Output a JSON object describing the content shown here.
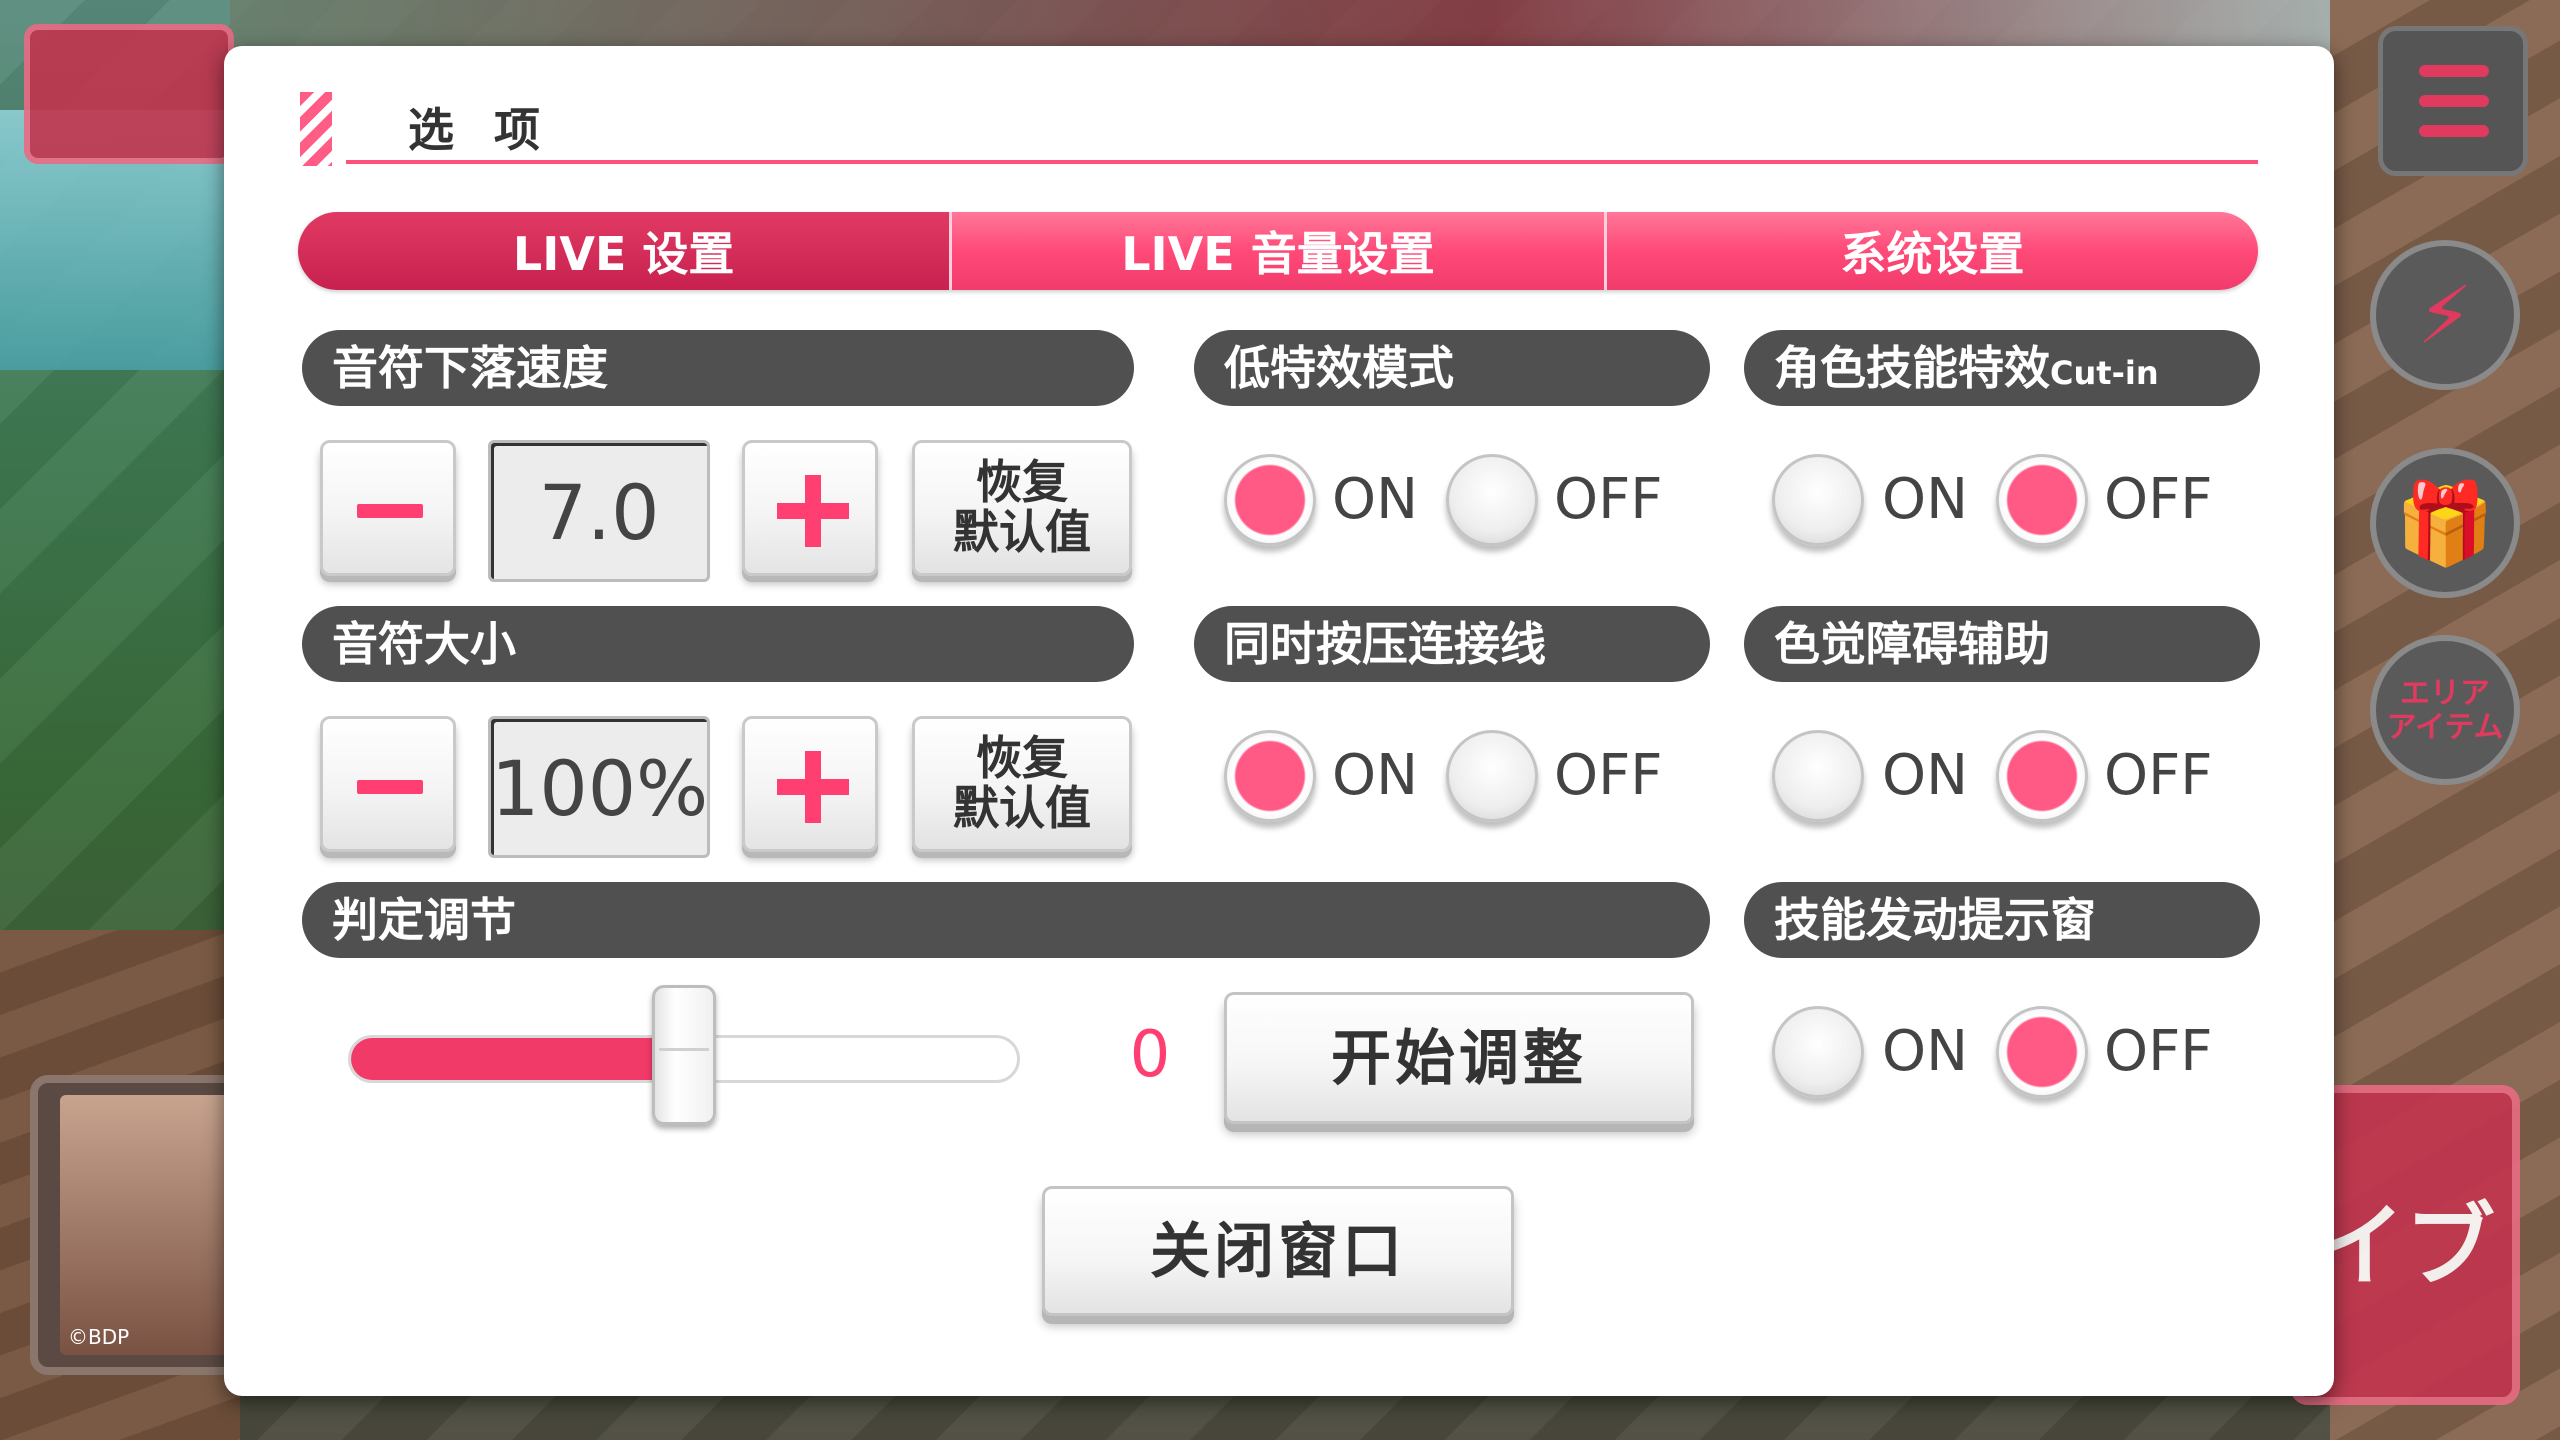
{
  "hud": {
    "area_item_label": "エリア\nアイテム",
    "card_credit": "©BDP",
    "live_button_label": "イブ"
  },
  "options": {
    "title": "选项",
    "tabs": [
      {
        "label": "LIVE 设置",
        "active": true
      },
      {
        "label": "LIVE 音量设置",
        "active": false
      },
      {
        "label": "系统设置",
        "active": false
      }
    ],
    "note_speed": {
      "label": "音符下落速度",
      "value": "7.0",
      "reset_label": "恢复\n默认值"
    },
    "note_size": {
      "label": "音符大小",
      "value": "100%",
      "reset_label": "恢复\n默认值"
    },
    "judge_adjust": {
      "label": "判定调节",
      "value": "0",
      "slider_fraction": 0.5,
      "start_label": "开始调整"
    },
    "low_effect_mode": {
      "label": "低特效模式",
      "selected": "ON"
    },
    "simul_line": {
      "label": "同时按压连接线",
      "selected": "ON"
    },
    "cutin": {
      "label": "角色技能特效",
      "label_suffix": "Cut-in",
      "selected": "OFF"
    },
    "colorblind": {
      "label": "色觉障碍辅助",
      "selected": "OFF"
    },
    "skill_popup": {
      "label": "技能发动提示窗",
      "selected": "OFF"
    },
    "on_label": "ON",
    "off_label": "OFF",
    "close_label": "关闭窗口"
  },
  "colors": {
    "accent": "#ff3f72",
    "tab_active": "#c8214f",
    "header_bg": "#505050"
  }
}
